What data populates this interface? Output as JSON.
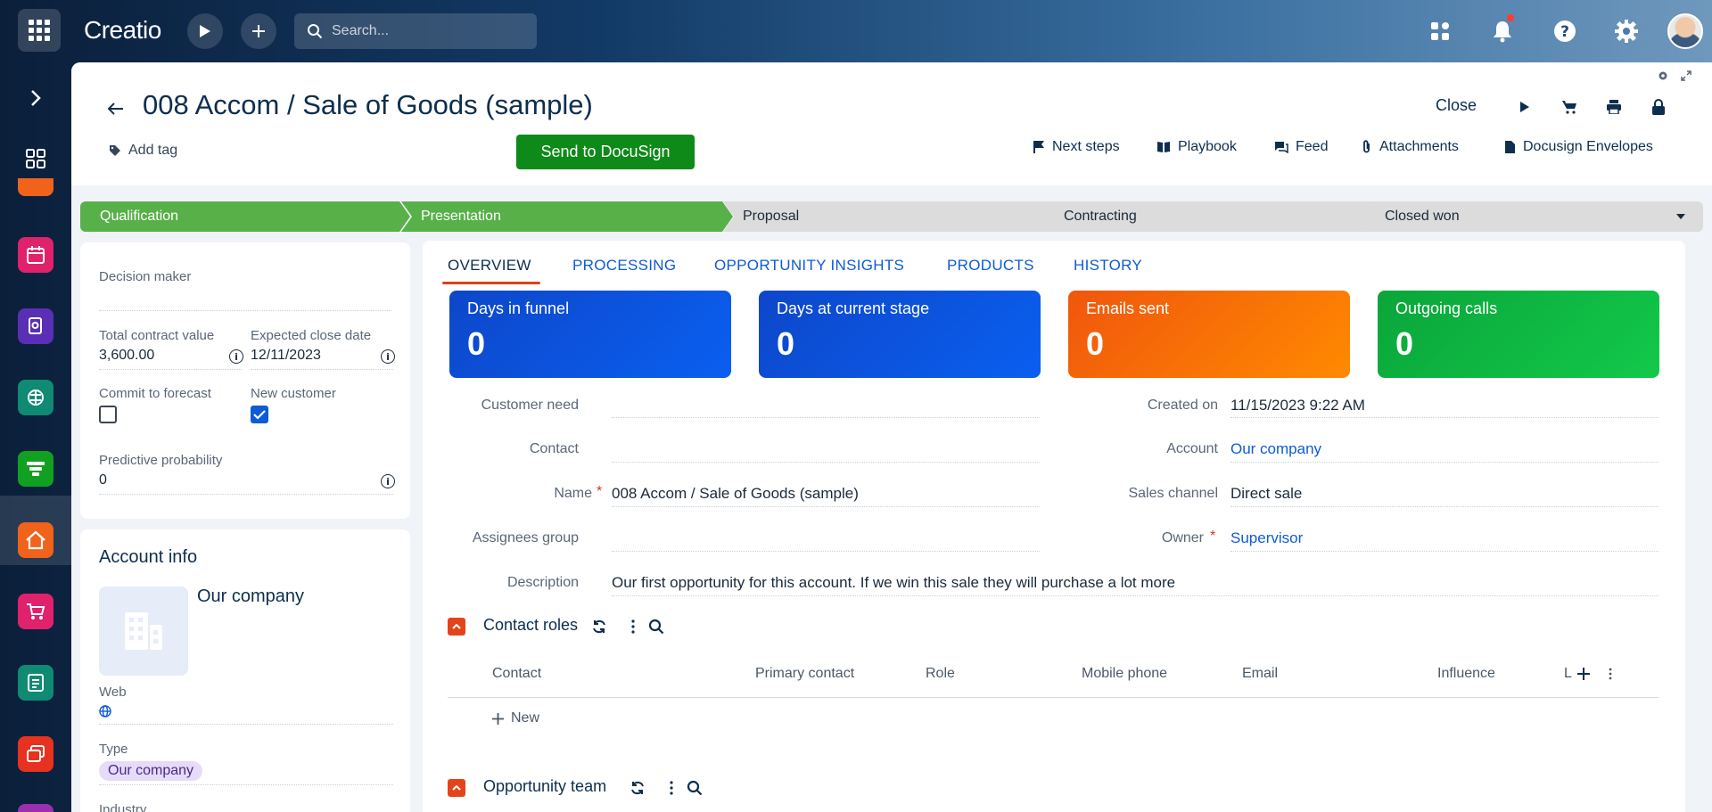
{
  "app": {
    "logo": "Creatio",
    "search_placeholder": "Search..."
  },
  "page": {
    "title": "008 Accom / Sale of Goods (sample)",
    "add_tag": "Add tag",
    "docusign_button": "Send to DocuSign",
    "close_button": "Close",
    "actions": [
      "Next steps",
      "Playbook",
      "Feed",
      "Attachments",
      "Docusign Envelopes"
    ]
  },
  "stages": [
    {
      "label": "Qualification",
      "status": "done"
    },
    {
      "label": "Presentation",
      "status": "done"
    },
    {
      "label": "Proposal",
      "status": "todo"
    },
    {
      "label": "Contracting",
      "status": "todo"
    },
    {
      "label": "Closed won",
      "status": "todo"
    }
  ],
  "left_panel": {
    "decision_maker_label": "Decision maker",
    "decision_maker_value": "",
    "total_contract_value_label": "Total contract value",
    "total_contract_value": "3,600.00",
    "expected_close_date_label": "Expected close date",
    "expected_close_date": "12/11/2023",
    "commit_to_forecast_label": "Commit to forecast",
    "commit_to_forecast": false,
    "new_customer_label": "New customer",
    "new_customer": true,
    "predictive_probability_label": "Predictive probability",
    "predictive_probability": "0"
  },
  "account_info": {
    "heading": "Account info",
    "company_name": "Our company",
    "web_label": "Web",
    "type_label": "Type",
    "type_value": "Our company",
    "industry_label": "Industry"
  },
  "tabs": [
    "OVERVIEW",
    "PROCESSING",
    "OPPORTUNITY INSIGHTS",
    "PRODUCTS",
    "HISTORY"
  ],
  "metrics": [
    {
      "label": "Days in funnel",
      "value": "0",
      "color": "#0d47c9"
    },
    {
      "label": "Days at current stage",
      "value": "0",
      "color": "#0d47c9"
    },
    {
      "label": "Emails sent",
      "value": "0",
      "color": "#f0560d"
    },
    {
      "label": "Outgoing calls",
      "value": "0",
      "color": "#0aa53a"
    }
  ],
  "fields": {
    "customer_need_label": "Customer need",
    "customer_need": "",
    "contact_label": "Contact",
    "contact": "",
    "name_label": "Name",
    "name": "008 Accom / Sale of Goods (sample)",
    "assignees_group_label": "Assignees group",
    "assignees_group": "",
    "description_label": "Description",
    "description": "Our first opportunity for this account. If we win this sale they will purchase a lot more",
    "created_on_label": "Created on",
    "created_on": "11/15/2023 9:22 AM",
    "account_label": "Account",
    "account": "Our company",
    "sales_channel_label": "Sales channel",
    "sales_channel": "Direct sale",
    "owner_label": "Owner",
    "owner": "Supervisor"
  },
  "contact_roles": {
    "title": "Contact roles",
    "columns": [
      "Contact",
      "Primary contact",
      "Role",
      "Mobile phone",
      "Email",
      "Influence",
      "L"
    ],
    "new_label": "New"
  },
  "opportunity_team": {
    "title": "Opportunity team"
  },
  "colors": {
    "accent": "#0d5bd7",
    "stage_done": "#58b049",
    "stage_todo": "#dcdcdc",
    "docusign_green": "#0e8a18",
    "section_orange": "#e5441a"
  },
  "icons": {
    "left_nav": [
      "chevron-right-icon",
      "dashboard-icon",
      "calendar-icon",
      "documents-icon",
      "ai-brain-icon",
      "funnel-icon",
      "home-icon",
      "cart-icon",
      "contract-icon",
      "cards-icon"
    ]
  }
}
